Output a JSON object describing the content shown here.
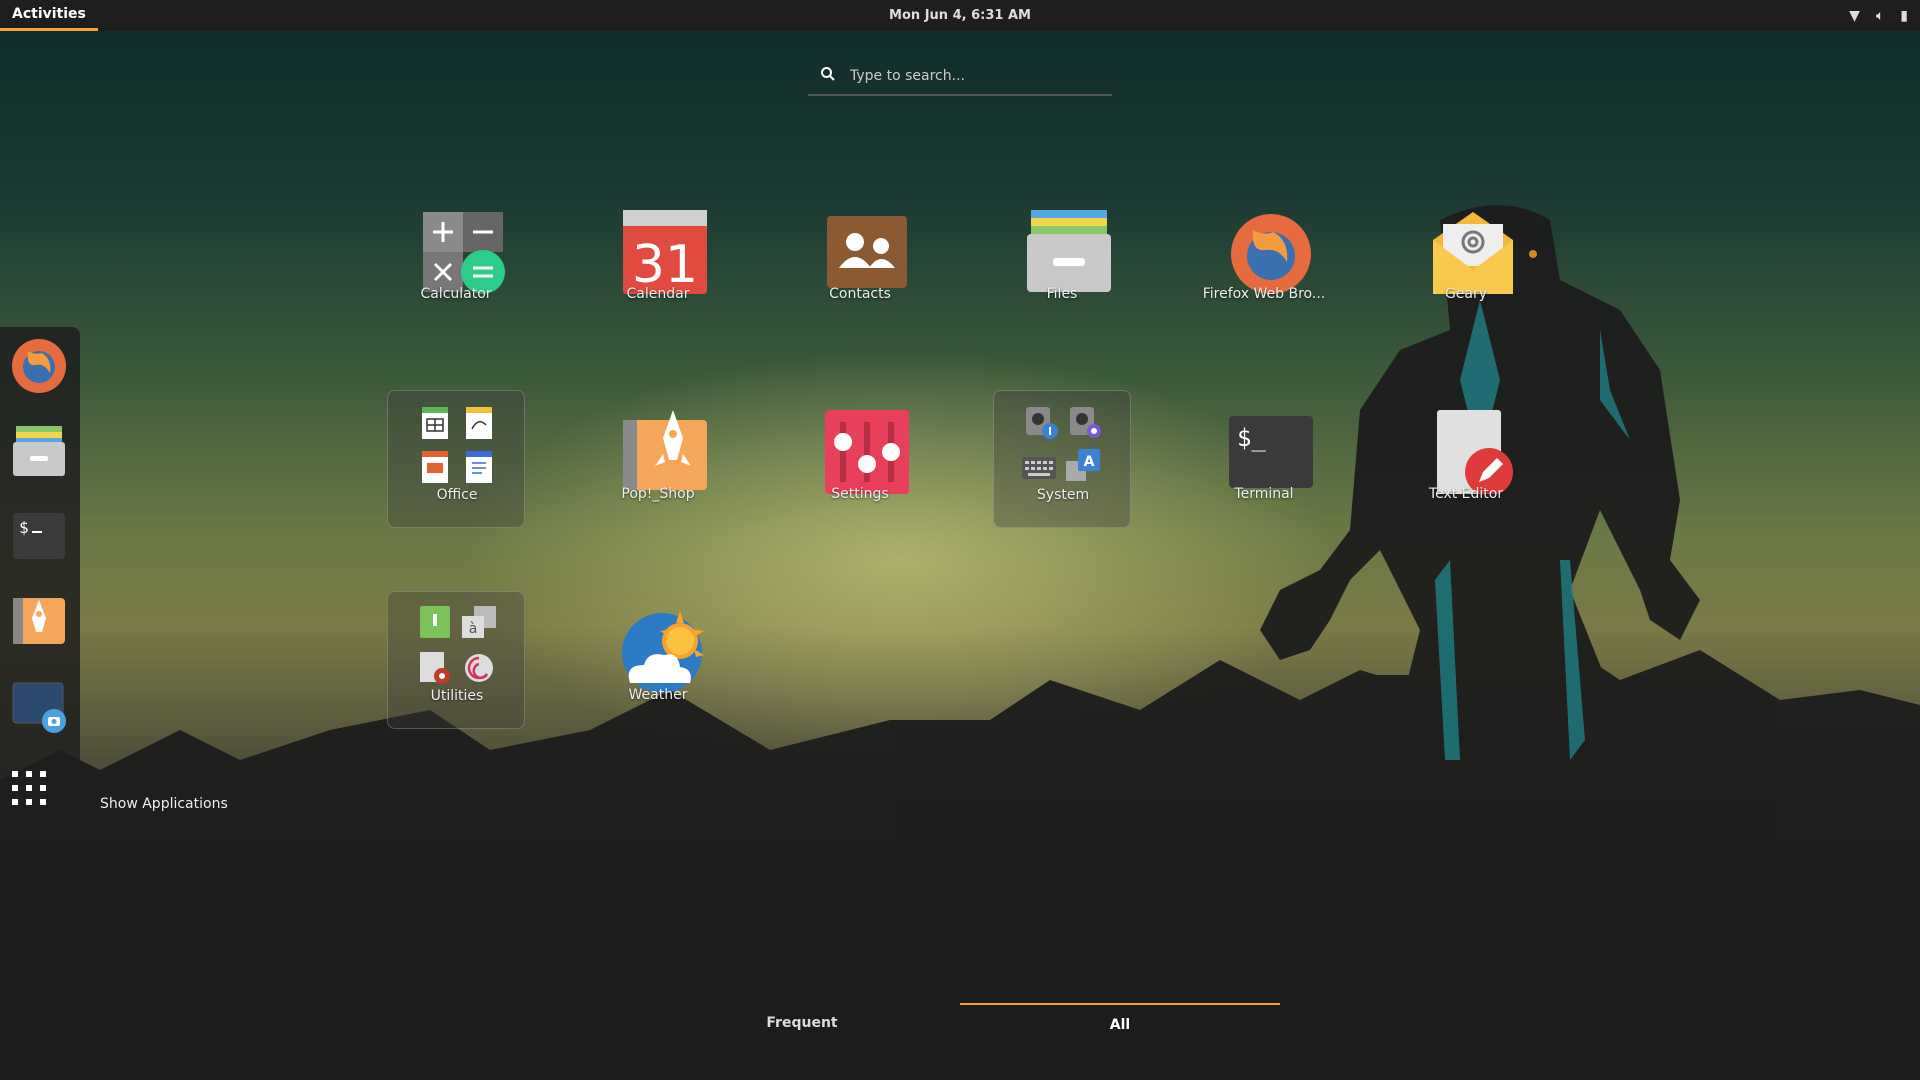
{
  "topbar": {
    "activities": "Activities",
    "clock": "Mon Jun  4,  6:31 AM",
    "tray": {
      "wifi_icon": "wifi-icon",
      "volume_icon": "volume-icon",
      "battery_icon": "battery-icon"
    }
  },
  "search": {
    "placeholder": "Type to search..."
  },
  "dash": {
    "items": [
      "Firefox Web Browser",
      "Files",
      "Terminal",
      "Pop!_Shop",
      "Screenshot"
    ],
    "show_apps_tooltip": "Show Applications"
  },
  "apps": [
    {
      "label": "Calculator"
    },
    {
      "label": "Calendar",
      "icon_text": "31"
    },
    {
      "label": "Contacts"
    },
    {
      "label": "Files"
    },
    {
      "label": "Firefox Web Bro..."
    },
    {
      "label": "Geary"
    },
    {
      "label": "Office"
    },
    {
      "label": "Pop!_Shop"
    },
    {
      "label": "Settings"
    },
    {
      "label": "System"
    },
    {
      "label": "Terminal",
      "icon_text": "$_"
    },
    {
      "label": "Text Editor"
    },
    {
      "label": "Utilities"
    },
    {
      "label": "Weather"
    }
  ],
  "tabs": {
    "frequent": "Frequent",
    "all": "All",
    "active": "All"
  },
  "colors": {
    "accent": "#f8a12c",
    "topbar": "#1e1e1e"
  }
}
